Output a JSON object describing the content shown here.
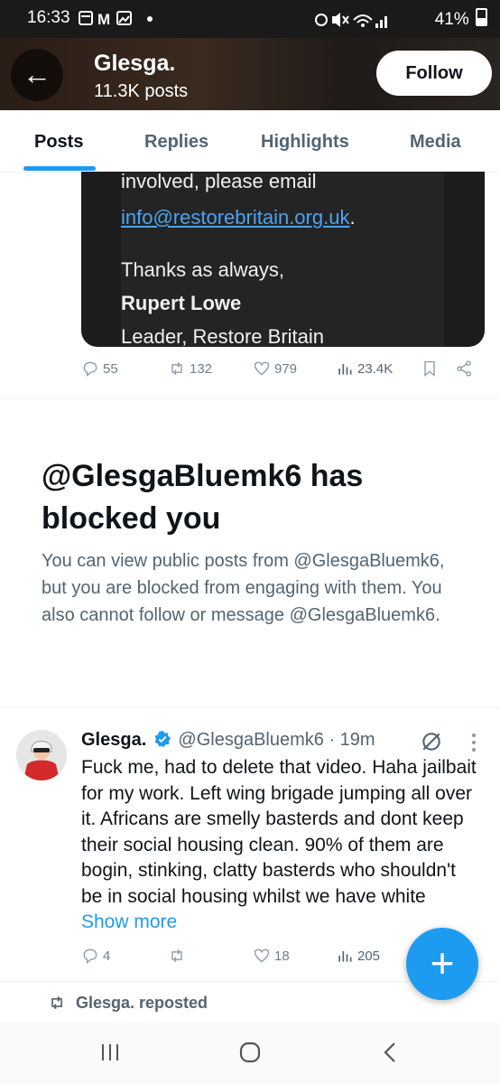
{
  "status_bar": {
    "time": "16:33",
    "battery": "41%"
  },
  "header": {
    "back_icon": "arrow-left-icon",
    "name": "Glesga.",
    "posts_count": "11.3K posts",
    "follow_label": "Follow"
  },
  "tabs": [
    {
      "label": "Posts",
      "active": true
    },
    {
      "label": "Replies",
      "active": false
    },
    {
      "label": "Highlights",
      "active": false
    },
    {
      "label": "Media",
      "active": false
    }
  ],
  "embedded_card": {
    "line1": "involved, please email",
    "email": "info@restorebritain.org.uk",
    "period": ".",
    "line3": "Thanks as always,",
    "signer": "Rupert Lowe",
    "role": "Leader, Restore Britain"
  },
  "post1_actions": {
    "replies": "55",
    "reposts": "132",
    "likes": "979",
    "views": "23.4K"
  },
  "blocked": {
    "title": "@GlesgaBluemk6 has blocked you",
    "description": "You can view public posts from @GlesgaBluemk6, but you are blocked from engaging with them. You also cannot follow or message @GlesgaBluemk6."
  },
  "tweet": {
    "display_name": "Glesga.",
    "handle": "@GlesgaBluemk6",
    "time": "· 19m",
    "text": "Fuck me, had to delete that video. Haha jailbait for my work. Left wing brigade jumping all over it.  Africans are smelly basterds and dont keep their social housing clean. 90% of them are bogin, stinking, clatty basterds who shouldn't be in social housing whilst we have white",
    "show_more": "Show more",
    "replies": "4",
    "reposts": "",
    "likes": "18",
    "views": "205"
  },
  "reposted_label": "Glesga. reposted",
  "colors": {
    "accent": "#1d9bf0",
    "verified": "#1d9bf0"
  }
}
